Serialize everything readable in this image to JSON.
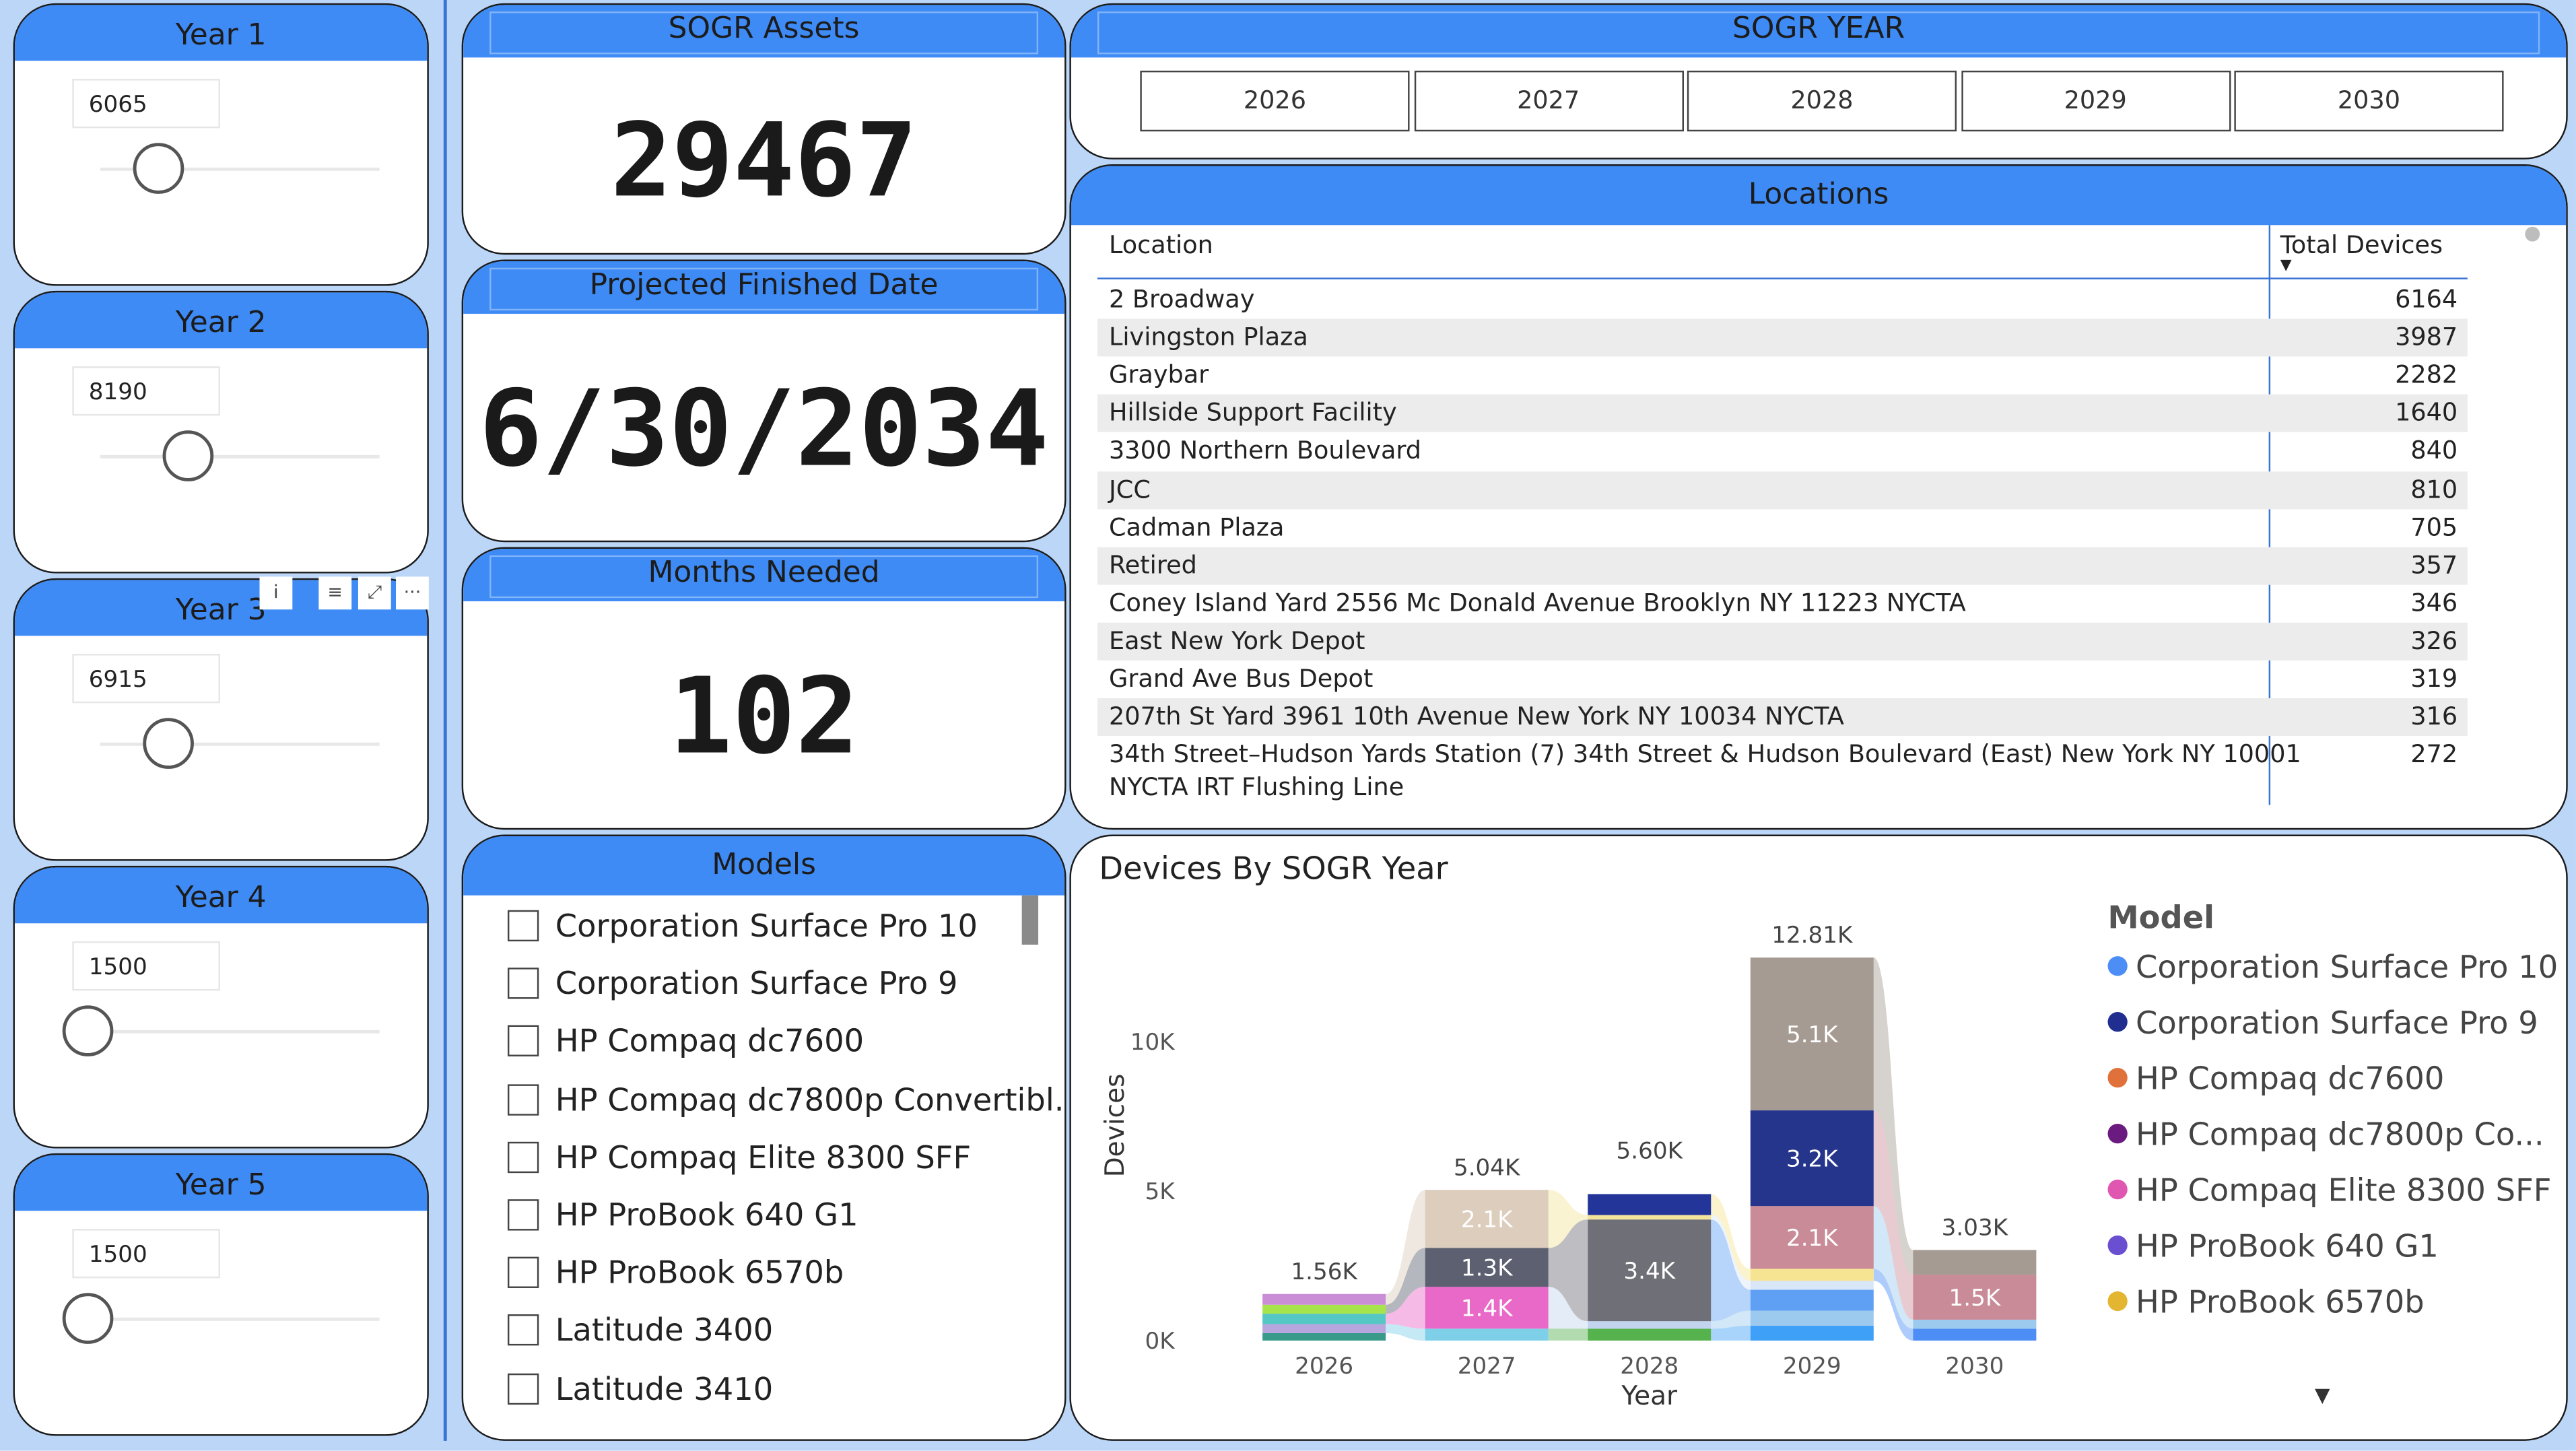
{
  "sliders": [
    {
      "title": "Year 1",
      "value": "6065",
      "level": 0.25
    },
    {
      "title": "Year 2",
      "value": "8190",
      "level": 0.36
    },
    {
      "title": "Year 3",
      "value": "6915",
      "level": 0.29
    },
    {
      "title": "Year 4",
      "value": "1500",
      "level": 0.0
    },
    {
      "title": "Year 5",
      "value": "1500",
      "level": 0.0
    }
  ],
  "kpis": {
    "assets_title": "SOGR Assets",
    "assets_value": "29467",
    "finish_title": "Projected Finished Date",
    "finish_value": "6/30/2034",
    "months_title": "Months Needed",
    "months_value": "102"
  },
  "sogr_year": {
    "title": "SOGR YEAR",
    "years": [
      "2026",
      "2027",
      "2028",
      "2029",
      "2030"
    ]
  },
  "locations": {
    "title": "Locations",
    "col_location": "Location",
    "col_total": "Total Devices",
    "rows": [
      {
        "location": "2 Broadway",
        "total": "6164"
      },
      {
        "location": "Livingston Plaza",
        "total": "3987"
      },
      {
        "location": "Graybar",
        "total": "2282"
      },
      {
        "location": "Hillside Support Facility",
        "total": "1640"
      },
      {
        "location": "3300 Northern Boulevard",
        "total": "840"
      },
      {
        "location": "JCC",
        "total": "810"
      },
      {
        "location": "Cadman Plaza",
        "total": "705"
      },
      {
        "location": "Retired",
        "total": "357"
      },
      {
        "location": "Coney Island Yard 2556 Mc Donald Avenue Brooklyn NY 11223 NYCTA",
        "total": "346"
      },
      {
        "location": "East New York Depot",
        "total": "326"
      },
      {
        "location": "Grand Ave Bus Depot",
        "total": "319"
      },
      {
        "location": "207th St Yard 3961 10th Avenue New York NY 10034 NYCTA",
        "total": "316"
      },
      {
        "location": "34th Street–Hudson Yards Station (7) 34th Street & Hudson Boulevard (East) New York NY 10001",
        "location2": "NYCTA IRT Flushing Line",
        "total": "272"
      }
    ]
  },
  "models": {
    "title": "Models",
    "items": [
      "Corporation Surface Pro 10",
      "Corporation Surface Pro 9",
      "HP Compaq dc7600",
      "HP Compaq dc7800p Convertibl...",
      "HP Compaq Elite 8300 SFF",
      "HP ProBook 640 G1",
      "HP ProBook 6570b",
      "Latitude 3400",
      "Latitude 3410"
    ]
  },
  "visual_header": {
    "info": "i",
    "filter": "≡",
    "focus": "⤢",
    "more": "···"
  },
  "chart": {
    "title": "Devices By SOGR Year",
    "legend_title": "Model",
    "legend": [
      {
        "name": "Corporation Surface Pro 10",
        "color": "#4c8df6"
      },
      {
        "name": "Corporation Surface Pro 9",
        "color": "#1f2e8f"
      },
      {
        "name": "HP Compaq dc7600",
        "color": "#e0713a"
      },
      {
        "name": "HP Compaq dc7800p Co...",
        "color": "#6b1a7f"
      },
      {
        "name": "HP Compaq Elite 8300 SFF",
        "color": "#e057b1"
      },
      {
        "name": "HP ProBook 640 G1",
        "color": "#6a4fd0"
      },
      {
        "name": "HP ProBook 6570b",
        "color": "#e3b530"
      }
    ],
    "more_arrow": "▼"
  },
  "chart_data": {
    "type": "bar",
    "stacked": true,
    "ribbon": true,
    "xlabel": "Year",
    "ylabel": "Devices",
    "categories": [
      "2026",
      "2027",
      "2028",
      "2029",
      "2030"
    ],
    "totals": [
      1560,
      5040,
      5600,
      12810,
      3030
    ],
    "total_labels": [
      "1.56K",
      "5.04K",
      "5.60K",
      "12.81K",
      "3.03K"
    ],
    "yticks": [
      "0K",
      "5K",
      "10K"
    ],
    "yvalues": [
      0,
      5000,
      10000
    ],
    "ylim": [
      0,
      12810
    ],
    "segments": [
      {
        "year": "2026",
        "value": 250,
        "color": "#3a9a8a",
        "label": ""
      },
      {
        "year": "2026",
        "value": 300,
        "color": "#b7a6de",
        "label": ""
      },
      {
        "year": "2026",
        "value": 350,
        "color": "#55c7c4",
        "label": ""
      },
      {
        "year": "2026",
        "value": 300,
        "color": "#a7e34a",
        "label": ""
      },
      {
        "year": "2026",
        "value": 360,
        "color": "#c98ed6",
        "label": ""
      },
      {
        "year": "2027",
        "value": 400,
        "color": "#7ecfe8",
        "label": ""
      },
      {
        "year": "2027",
        "value": 1400,
        "color": "#e869c8",
        "label": "1.4K"
      },
      {
        "year": "2027",
        "value": 1300,
        "color": "#5c6070",
        "label": "1.3K"
      },
      {
        "year": "2027",
        "value": 1940,
        "color": "#dccdbc",
        "label": "2.1K"
      },
      {
        "year": "2028",
        "value": 400,
        "color": "#55b24d",
        "label": ""
      },
      {
        "year": "2028",
        "value": 250,
        "color": "#c2d4ee",
        "label": ""
      },
      {
        "year": "2028",
        "value": 3400,
        "color": "#6f6f78",
        "label": "3.4K"
      },
      {
        "year": "2028",
        "value": 150,
        "color": "#f2e49a",
        "label": ""
      },
      {
        "year": "2028",
        "value": 700,
        "color": "#24359a",
        "label": ""
      },
      {
        "year": "2029",
        "value": 500,
        "color": "#3ea0f6",
        "label": ""
      },
      {
        "year": "2029",
        "value": 500,
        "color": "#9cc9ee",
        "label": ""
      },
      {
        "year": "2029",
        "value": 700,
        "color": "#5fa0f4",
        "label": ""
      },
      {
        "year": "2029",
        "value": 300,
        "color": "#d9e6f7",
        "label": ""
      },
      {
        "year": "2029",
        "value": 400,
        "color": "#f6e493",
        "label": ""
      },
      {
        "year": "2029",
        "value": 2100,
        "color": "#c98b97",
        "label": "2.1K"
      },
      {
        "year": "2029",
        "value": 3200,
        "color": "#26358c",
        "label": "3.2K"
      },
      {
        "year": "2029",
        "value": 5110,
        "color": "#a59b92",
        "label": "5.1K"
      },
      {
        "year": "2030",
        "value": 400,
        "color": "#4c8df6",
        "label": ""
      },
      {
        "year": "2030",
        "value": 300,
        "color": "#9cc9ee",
        "label": ""
      },
      {
        "year": "2030",
        "value": 1500,
        "color": "#c98b97",
        "label": "1.5K"
      },
      {
        "year": "2030",
        "value": 830,
        "color": "#a59b92",
        "label": ""
      }
    ]
  }
}
